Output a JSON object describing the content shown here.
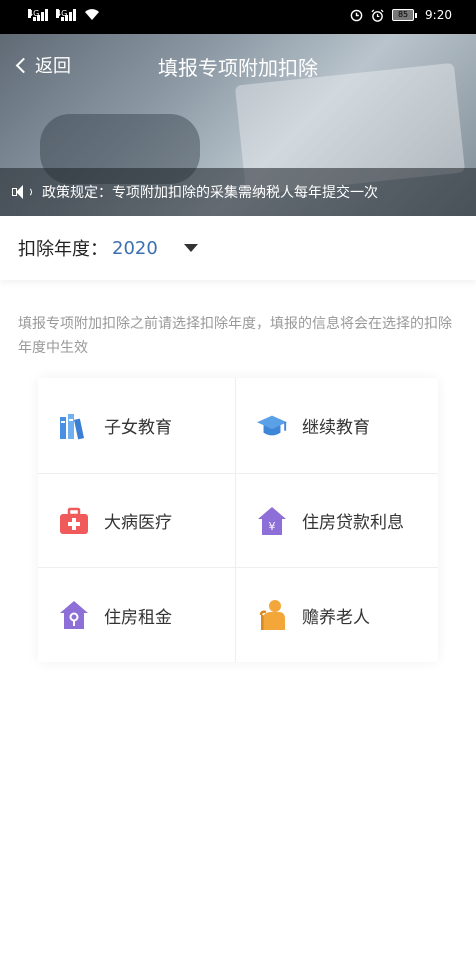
{
  "status_bar": {
    "sim1": "4G",
    "sim2": "4G",
    "battery": "85",
    "time": "9:20",
    "icons": [
      "signal-icon",
      "wifi-icon",
      "clock-icon",
      "alarm-icon",
      "battery-icon"
    ]
  },
  "header": {
    "back_label": "返回",
    "title": "填报专项附加扣除",
    "policy_text": "政策规定：专项附加扣除的采集需纳税人每年提交一次"
  },
  "year_selector": {
    "label": "扣除年度：",
    "value": "2020"
  },
  "hint": "填报专项附加扣除之前请选择扣除年度，填报的信息将会在选择的扣除年度中生效",
  "categories": [
    {
      "label": "子女教育",
      "icon": "books-icon",
      "color": "#4a90e2"
    },
    {
      "label": "继续教育",
      "icon": "graduation-cap-icon",
      "color": "#5aa0e6"
    },
    {
      "label": "大病医疗",
      "icon": "medical-kit-icon",
      "color": "#f05a5a"
    },
    {
      "label": "住房贷款利息",
      "icon": "house-yen-icon",
      "color": "#8e6fd8"
    },
    {
      "label": "住房租金",
      "icon": "house-key-icon",
      "color": "#8e6fd8"
    },
    {
      "label": "赡养老人",
      "icon": "elderly-person-icon",
      "color": "#f3a63a"
    }
  ]
}
